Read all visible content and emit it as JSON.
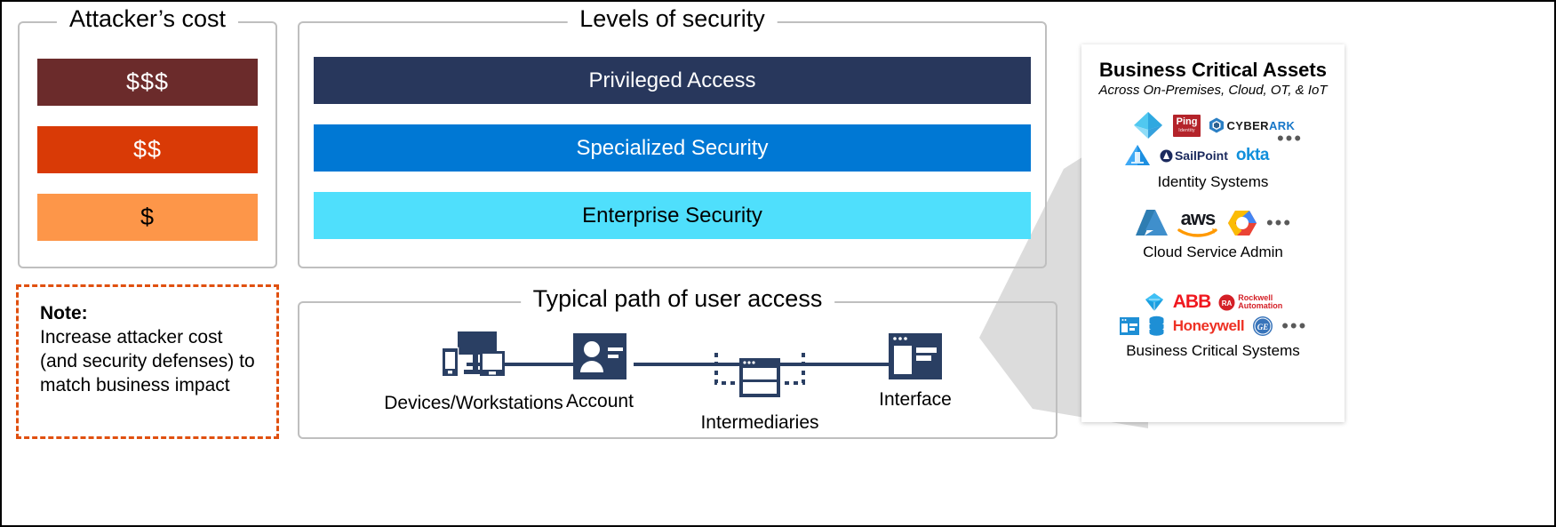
{
  "attacker_cost": {
    "title": "Attacker’s cost",
    "bars": [
      {
        "label": "$$$",
        "bg": "#6b2b2b",
        "fg": "#ffffff"
      },
      {
        "label": "$$",
        "bg": "#d93a06",
        "fg": "#ffffff"
      },
      {
        "label": "$",
        "bg": "#fd9649",
        "fg": "#000000"
      }
    ]
  },
  "note": {
    "title": "Note:",
    "body": "Increase attacker cost (and security defenses) to match business impact",
    "border_color": "#e0500f"
  },
  "levels": {
    "title": "Levels of security",
    "bars": [
      {
        "label": "Privileged Access",
        "bg": "#28375c",
        "fg": "#ffffff"
      },
      {
        "label": "Specialized Security",
        "bg": "#0078d4",
        "fg": "#ffffff"
      },
      {
        "label": "Enterprise Security",
        "bg": "#4fdffc",
        "fg": "#000000"
      }
    ]
  },
  "path": {
    "title": "Typical path of user access",
    "nodes": [
      {
        "label": "Devices/Workstations",
        "icon": "devices-workstations-icon"
      },
      {
        "label": "Account",
        "icon": "account-card-icon"
      },
      {
        "label": "Intermediaries",
        "icon": "intermediaries-icon"
      },
      {
        "label": "Interface",
        "icon": "interface-window-icon"
      }
    ],
    "accent": "#2a3f63"
  },
  "assets": {
    "title": "Business Critical Assets",
    "subtitle": "Across On-Premises, Cloud, OT, & IoT",
    "groups": [
      {
        "caption": "Identity Systems",
        "logos": [
          "azure-ad-icon",
          "ping-identity-logo",
          "cyberark-logo",
          "active-directory-icon",
          "sailpoint-logo",
          "okta-logo"
        ],
        "more": "•••"
      },
      {
        "caption": "Cloud Service Admin",
        "logos": [
          "azure-logo",
          "aws-logo",
          "google-cloud-logo"
        ],
        "more": "•••"
      },
      {
        "caption": "Business Critical Systems",
        "logos": [
          "sap-diamond-icon",
          "abb-logo",
          "rockwell-automation-logo",
          "erp-window-icon",
          "database-icon",
          "honeywell-logo",
          "ge-logo"
        ],
        "more": "•••"
      }
    ],
    "logo_text": {
      "ping_main": "Ping",
      "ping_sub": "Identity",
      "cyberark_1": "CYBER",
      "cyberark_2": "ARK",
      "sailpoint": "SailPoint",
      "okta": "okta",
      "aws": "aws",
      "abb": "ABB",
      "rockwell_1": "Rockwell",
      "rockwell_2": "Automation",
      "honeywell": "Honeywell"
    }
  },
  "colors": {
    "frame_gray": "#bfbfbf",
    "funnel_gray": "#dcdcdc",
    "dark_navy": "#28375c"
  }
}
